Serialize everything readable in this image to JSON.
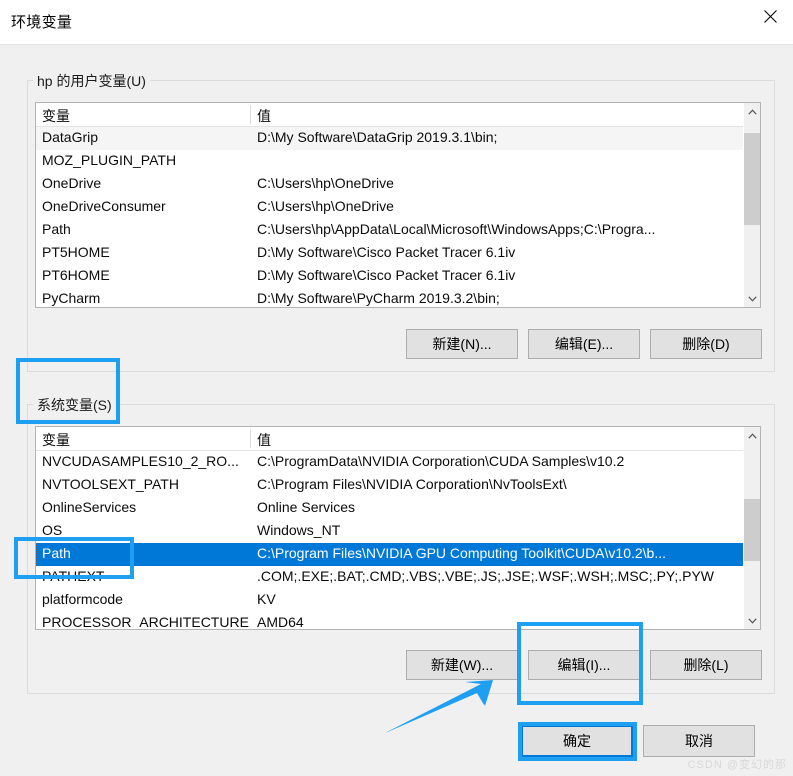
{
  "window": {
    "title": "环境变量",
    "close_icon": "close-icon",
    "watermark": "CSDN @变幻的那"
  },
  "user_variables": {
    "legend": "hp 的用户变量(U)",
    "columns": [
      "变量",
      "值"
    ],
    "rows": [
      {
        "name": "DataGrip",
        "value": "D:\\My Software\\DataGrip 2019.3.1\\bin;"
      },
      {
        "name": "MOZ_PLUGIN_PATH",
        "value": ""
      },
      {
        "name": "OneDrive",
        "value": "C:\\Users\\hp\\OneDrive"
      },
      {
        "name": "OneDriveConsumer",
        "value": "C:\\Users\\hp\\OneDrive"
      },
      {
        "name": "Path",
        "value": "C:\\Users\\hp\\AppData\\Local\\Microsoft\\WindowsApps;C:\\Progra..."
      },
      {
        "name": "PT5HOME",
        "value": "D:\\My Software\\Cisco Packet Tracer 6.1iv"
      },
      {
        "name": "PT6HOME",
        "value": "D:\\My Software\\Cisco Packet Tracer 6.1iv"
      },
      {
        "name": "PyCharm",
        "value": "D:\\My Software\\PyCharm 2019.3.2\\bin;"
      }
    ],
    "buttons": {
      "new": "新建(N)...",
      "edit": "编辑(E)...",
      "delete": "删除(D)"
    },
    "scrollbar": {
      "up_icon": "chevron-up-icon",
      "down_icon": "chevron-down-icon"
    }
  },
  "system_variables": {
    "legend": "系统变量(S)",
    "columns": [
      "变量",
      "值"
    ],
    "rows": [
      {
        "name": "NVCUDASAMPLES10_2_RO...",
        "value": "C:\\ProgramData\\NVIDIA Corporation\\CUDA Samples\\v10.2"
      },
      {
        "name": "NVTOOLSEXT_PATH",
        "value": "C:\\Program Files\\NVIDIA Corporation\\NvToolsExt\\"
      },
      {
        "name": "OnlineServices",
        "value": "Online Services"
      },
      {
        "name": "OS",
        "value": "Windows_NT"
      },
      {
        "name": "Path",
        "value": "C:\\Program Files\\NVIDIA GPU Computing Toolkit\\CUDA\\v10.2\\b..."
      },
      {
        "name": "PATHEXT",
        "value": ".COM;.EXE;.BAT;.CMD;.VBS;.VBE;.JS;.JSE;.WSF;.WSH;.MSC;.PY;.PYW"
      },
      {
        "name": "platformcode",
        "value": "KV"
      },
      {
        "name": "PROCESSOR_ARCHITECTURE",
        "value": "AMD64"
      }
    ],
    "selected_row_index": 4,
    "buttons": {
      "new": "新建(W)...",
      "edit": "编辑(I)...",
      "delete": "删除(L)"
    },
    "scrollbar": {
      "up_icon": "chevron-up-icon",
      "down_icon": "chevron-down-icon"
    }
  },
  "footer": {
    "ok": "确定",
    "cancel": "取消"
  },
  "colors": {
    "selection_blue": "#0078d7",
    "annotation_blue": "#1e9ff2",
    "dialog_bg": "#f0f0f0",
    "button_bg": "#e1e1e1"
  },
  "annotations": {
    "system_legend_box": "系统变量(S)",
    "system_path_row_box": "Path",
    "system_edit_button_box": "编辑(I)...",
    "ok_button_box": "确定",
    "arrow_icon": "arrow-up-right-icon"
  }
}
